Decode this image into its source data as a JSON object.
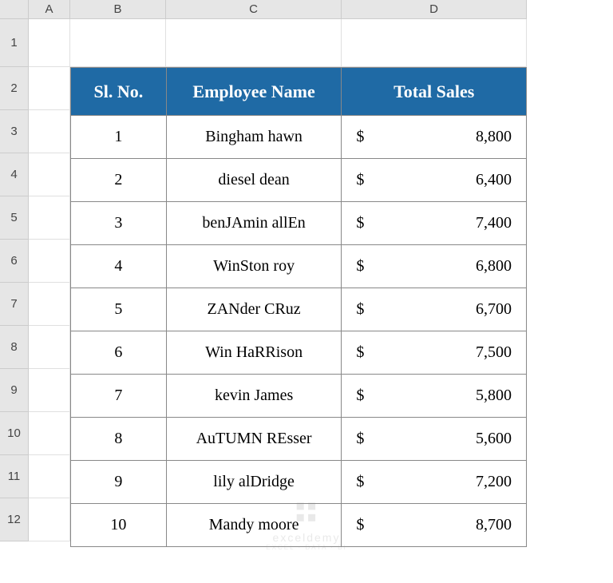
{
  "columns": [
    "A",
    "B",
    "C",
    "D"
  ],
  "rows": [
    "1",
    "2",
    "3",
    "4",
    "5",
    "6",
    "7",
    "8",
    "9",
    "10",
    "11",
    "12"
  ],
  "headers": {
    "sl_no": "Sl. No.",
    "employee_name": "Employee Name",
    "total_sales": "Total Sales"
  },
  "currency_symbol": "$",
  "data": [
    {
      "sl": "1",
      "name": "Bingham hawn",
      "sales": "8,800"
    },
    {
      "sl": "2",
      "name": "diesel dean",
      "sales": "6,400"
    },
    {
      "sl": "3",
      "name": "benJAmin allEn",
      "sales": "7,400"
    },
    {
      "sl": "4",
      "name": "WinSton roy",
      "sales": "6,800"
    },
    {
      "sl": "5",
      "name": "ZANder CRuz",
      "sales": "6,700"
    },
    {
      "sl": "6",
      "name": "Win HaRRison",
      "sales": "7,500"
    },
    {
      "sl": "7",
      "name": "kevin James",
      "sales": "5,800"
    },
    {
      "sl": "8",
      "name": "AuTUMN REsser",
      "sales": "5,600"
    },
    {
      "sl": "9",
      "name": "lily alDridge",
      "sales": "7,200"
    },
    {
      "sl": "10",
      "name": "Mandy moore",
      "sales": "8,700"
    }
  ],
  "watermark": {
    "text": "exceldemy",
    "sub": "EXCEL · DATA · BI"
  }
}
